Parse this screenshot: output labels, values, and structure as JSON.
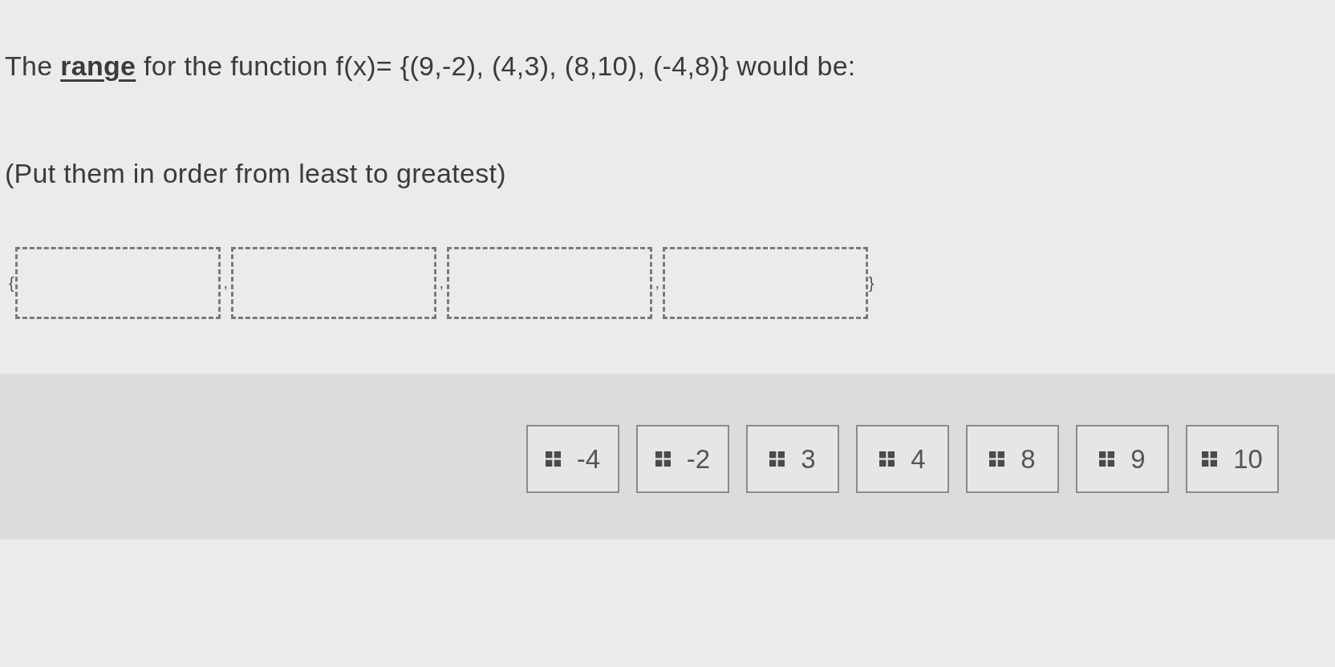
{
  "question": {
    "text": "The **range** for the function f(x)= {(9,-2), (4,3), (8,10), (-4,8)} would be:",
    "instruction": "(Put them in order from least to greatest)"
  },
  "answer_row": {
    "open_brace": "{",
    "separators": [
      ",",
      ",",
      ","
    ],
    "close_brace": "}"
  },
  "tiles": [
    "-4",
    "-2",
    "3",
    "4",
    "8",
    "9",
    "10"
  ]
}
